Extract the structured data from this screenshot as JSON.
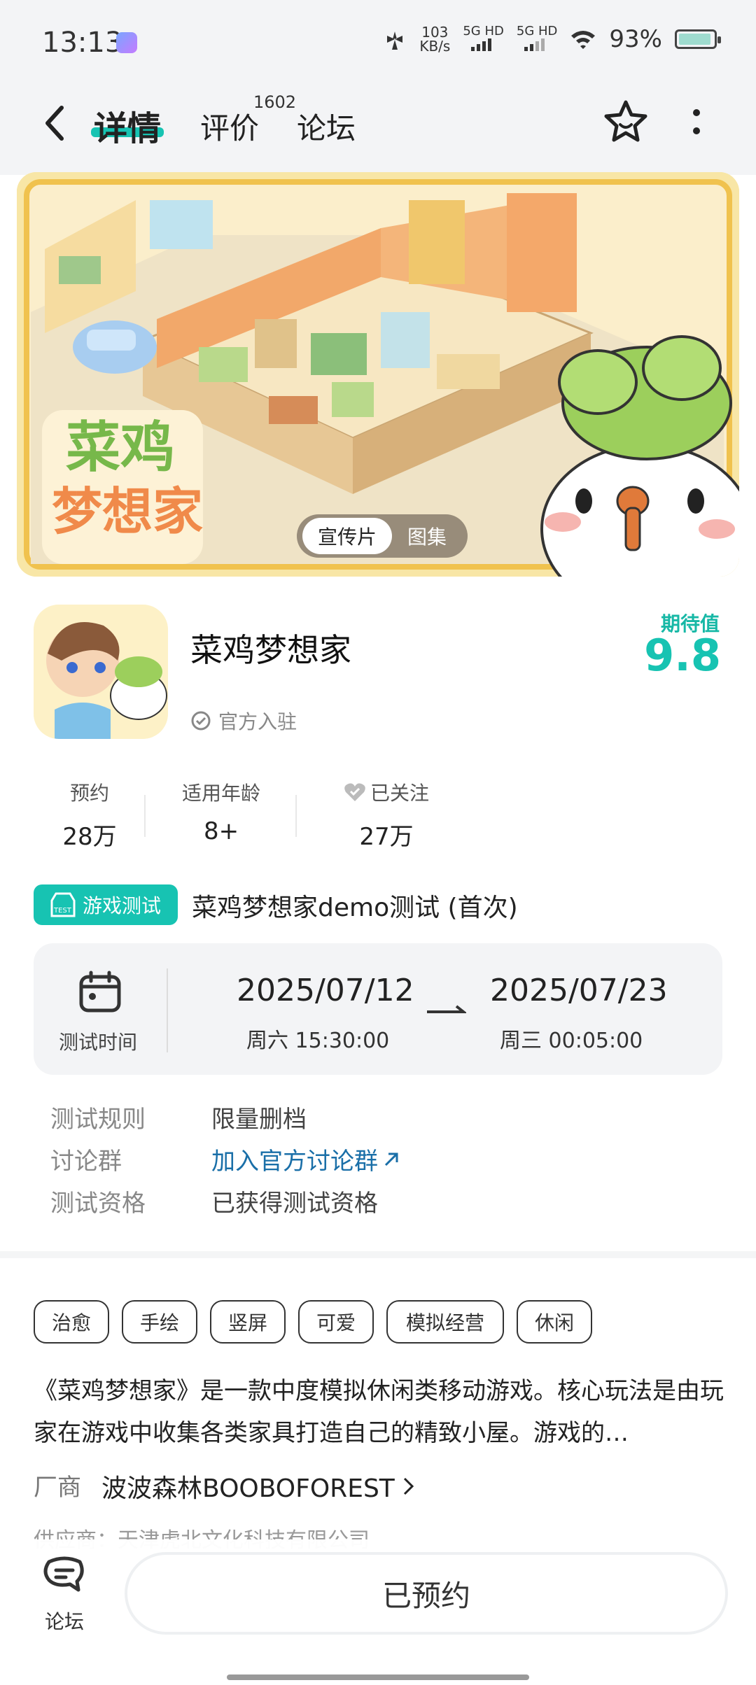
{
  "status_bar": {
    "time": "13:13",
    "net_speed_value": "103",
    "net_speed_unit": "KB/s",
    "sig1": "5G",
    "sig1_hd": "HD",
    "sig2": "5G",
    "sig2_hd": "HD",
    "battery_percent": "93%",
    "battery_level": 0.93
  },
  "nav": {
    "tabs": [
      {
        "label": "详情",
        "active": true
      },
      {
        "label": "评价",
        "count": "1602"
      },
      {
        "label": "论坛"
      }
    ]
  },
  "banner": {
    "pill_tabs": [
      "宣传片",
      "图集"
    ],
    "logo_text": "菜鸡梦想家"
  },
  "game": {
    "title": "菜鸡梦想家",
    "official_badge": "官方入驻",
    "expect_label": "期待值",
    "expect_score": "9.8"
  },
  "stats": [
    {
      "label": "预约",
      "value": "28万"
    },
    {
      "label": "适用年龄",
      "value": "8+"
    },
    {
      "label": "已关注",
      "value": "27万"
    }
  ],
  "test": {
    "tag_label": "游戏测试",
    "tag_icon_text": "TEST",
    "name": "菜鸡梦想家demo测试 (首次)",
    "time_label": "测试时间",
    "start_date": "2025/07/12",
    "start_day": "周六  15:30:00",
    "end_date": "2025/07/23",
    "end_day": "周三  00:05:00"
  },
  "rules": [
    {
      "label": "测试规则",
      "value": "限量删档",
      "link": false
    },
    {
      "label": "讨论群",
      "value": "加入官方讨论群",
      "link": true
    },
    {
      "label": "测试资格",
      "value": "已获得测试资格",
      "link": false
    }
  ],
  "tags": [
    "治愈",
    "手绘",
    "竖屏",
    "可爱",
    "模拟经营",
    "休闲"
  ],
  "description": "《菜鸡梦想家》是一款中度模拟休闲类移动游戏。核心玩法是由玩家在游戏中收集各类家具打造自己的精致小屋。游戏的…",
  "vendor": {
    "label": "厂商",
    "name": "波波森林BOOBOFOREST"
  },
  "supplier": "供应商：天津虎北文化科技有限公司",
  "bottom": {
    "forum_label": "论坛",
    "reserve_label": "已预约"
  },
  "colors": {
    "accent": "#17c3b2",
    "link": "#1a6fa8"
  }
}
